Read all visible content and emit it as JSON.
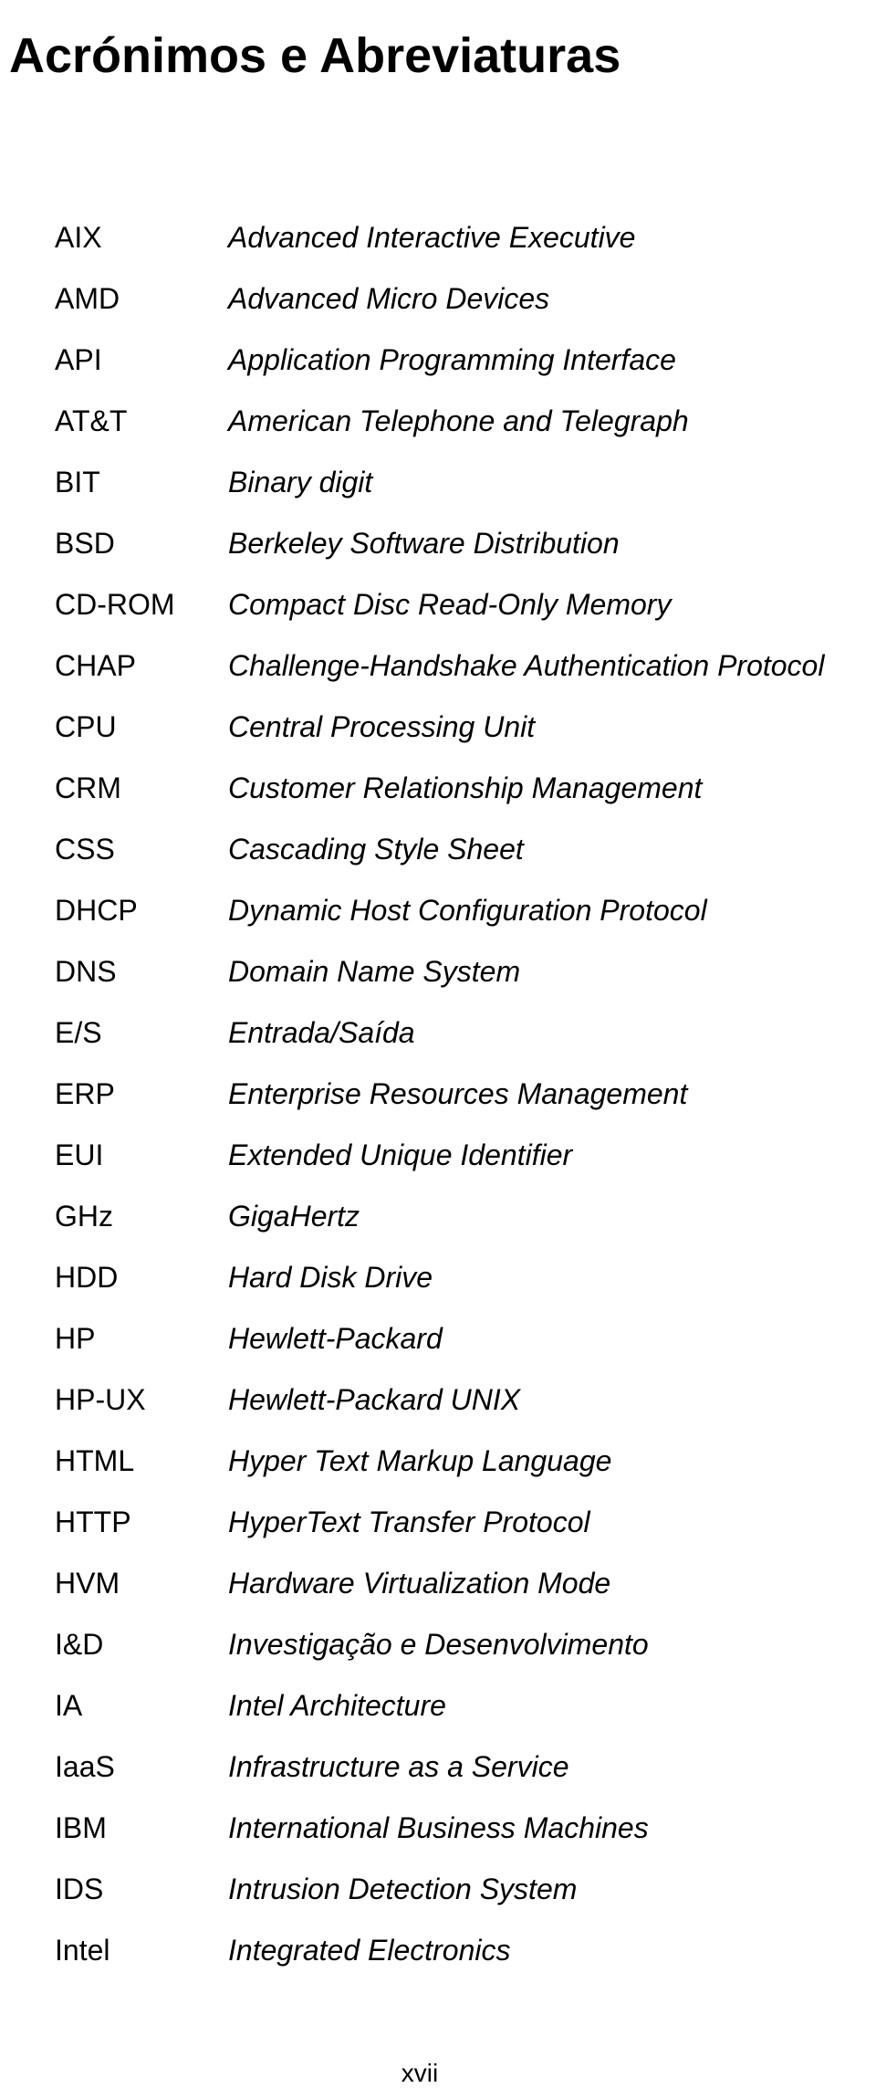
{
  "title": "Acrónimos e Abreviaturas",
  "pageNumber": "xvii",
  "entries": [
    {
      "acronym": "AIX",
      "definition": "Advanced Interactive Executive"
    },
    {
      "acronym": "AMD",
      "definition": "Advanced Micro Devices"
    },
    {
      "acronym": "API",
      "definition": "Application Programming Interface"
    },
    {
      "acronym": "AT&T",
      "definition": "American Telephone and Telegraph"
    },
    {
      "acronym": "BIT",
      "definition": "Binary digit"
    },
    {
      "acronym": "BSD",
      "definition": "Berkeley Software Distribution"
    },
    {
      "acronym": "CD-ROM",
      "definition": "Compact Disc Read-Only Memory"
    },
    {
      "acronym": "CHAP",
      "definition": "Challenge-Handshake Authentication Protocol"
    },
    {
      "acronym": "CPU",
      "definition": "Central Processing Unit"
    },
    {
      "acronym": "CRM",
      "definition": "Customer Relationship Management"
    },
    {
      "acronym": "CSS",
      "definition": "Cascading Style Sheet"
    },
    {
      "acronym": "DHCP",
      "definition": "Dynamic Host Configuration Protocol"
    },
    {
      "acronym": "DNS",
      "definition": "Domain Name System"
    },
    {
      "acronym": "E/S",
      "definition": "Entrada/Saída"
    },
    {
      "acronym": "ERP",
      "definition": "Enterprise Resources Management"
    },
    {
      "acronym": "EUI",
      "definition": "Extended Unique Identifier"
    },
    {
      "acronym": "GHz",
      "definition": "GigaHertz"
    },
    {
      "acronym": "HDD",
      "definition": "Hard Disk Drive"
    },
    {
      "acronym": "HP",
      "definition": "Hewlett-Packard"
    },
    {
      "acronym": "HP-UX",
      "definition": "Hewlett-Packard UNIX"
    },
    {
      "acronym": "HTML",
      "definition": "Hyper Text Markup Language"
    },
    {
      "acronym": "HTTP",
      "definition": "HyperText Transfer Protocol"
    },
    {
      "acronym": "HVM",
      "definition": "Hardware Virtualization Mode"
    },
    {
      "acronym": "I&D",
      "definition": "Investigação e Desenvolvimento"
    },
    {
      "acronym": "IA",
      "definition": "Intel Architecture"
    },
    {
      "acronym": "IaaS",
      "definition": "Infrastructure as a Service"
    },
    {
      "acronym": "IBM",
      "definition": "International Business Machines"
    },
    {
      "acronym": "IDS",
      "definition": "Intrusion Detection System"
    },
    {
      "acronym": "Intel",
      "definition": "Integrated Electronics"
    }
  ]
}
